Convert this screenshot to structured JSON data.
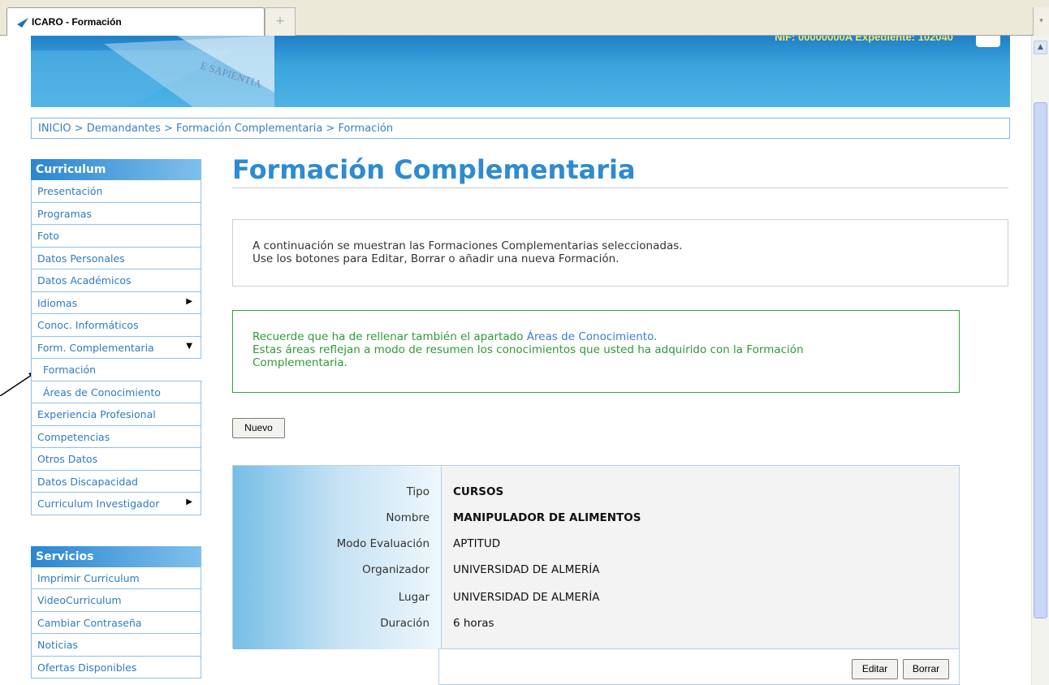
{
  "browser": {
    "tab_title": "ICARO - Formación",
    "new_tab_glyph": "+",
    "scroll_glyph": "▾"
  },
  "banner": {
    "nif_text": "NIF: 00000000A   Expediente: 102040",
    "seal_text": "E SAPIENTIA"
  },
  "breadcrumb": {
    "text": "INICIO > Demandantes > Formación Complementaria > Formación"
  },
  "sidebar": {
    "curriculum_title": "Curriculum",
    "curriculum_items": [
      {
        "label": "Presentación"
      },
      {
        "label": "Programas"
      },
      {
        "label": "Foto"
      },
      {
        "label": "Datos Personales"
      },
      {
        "label": "Datos Académicos"
      },
      {
        "label": "Idiomas",
        "arrow": "▶"
      },
      {
        "label": "Conoc. Informáticos"
      },
      {
        "label": "Form. Complementaria",
        "arrow": "▼"
      },
      {
        "label": "Formación"
      },
      {
        "label": "Áreas de Conocimiento"
      },
      {
        "label": "Experiencia Profesional"
      },
      {
        "label": "Competencias"
      },
      {
        "label": "Otros Datos"
      },
      {
        "label": "Datos Discapacidad"
      },
      {
        "label": "Curriculum Investigador",
        "arrow": "▶"
      }
    ],
    "servicios_title": "Servicios",
    "servicios_items": [
      {
        "label": "Imprimir Curriculum"
      },
      {
        "label": "VideoCurriculum"
      },
      {
        "label": "Cambiar Contraseña"
      },
      {
        "label": "Noticias"
      },
      {
        "label": "Ofertas Disponibles"
      }
    ]
  },
  "main": {
    "title": "Formación Complementaria",
    "info_line1": "A continuación se muestran las Formaciones Complementarias seleccionadas.",
    "info_line2": "Use los botones para Editar, Borrar o añadir una nueva Formación.",
    "notice_line1_pre": "Recuerde que ha de rellenar también el apartado ",
    "notice_link": "Áreas de Conocimiento",
    "notice_line1_post": ".",
    "notice_line2": "Estas áreas reflejan a modo de resumen los conocimientos que usted ha adquirido con la Formación",
    "notice_line3": "Complementaria.",
    "new_button": "Nuevo",
    "detail": [
      {
        "label": "Tipo",
        "value": "CURSOS"
      },
      {
        "label": "Nombre",
        "value": "MANIPULADOR DE ALIMENTOS"
      },
      {
        "label": "Modo Evaluación",
        "value": "APTITUD"
      },
      {
        "label": "Organizador",
        "value": "UNIVERSIDAD DE ALMERÍA"
      },
      {
        "label": "Lugar",
        "value": "UNIVERSIDAD DE ALMERÍA"
      },
      {
        "label": "Duración",
        "value": "6 horas"
      }
    ],
    "edit_button": "Editar",
    "delete_button": "Borrar"
  },
  "colors": {
    "accent_blue": "#2e8bd0",
    "notice_green": "#2e9a35",
    "nif_yellow": "#f5e66d"
  }
}
